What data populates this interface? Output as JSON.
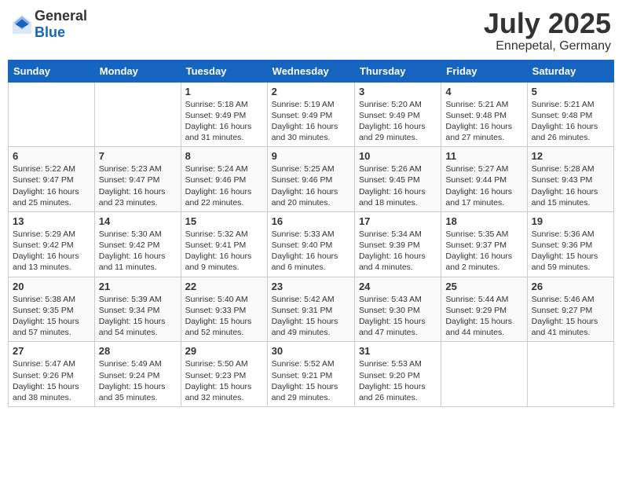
{
  "header": {
    "logo_general": "General",
    "logo_blue": "Blue",
    "month_year": "July 2025",
    "location": "Ennepetal, Germany"
  },
  "days_of_week": [
    "Sunday",
    "Monday",
    "Tuesday",
    "Wednesday",
    "Thursday",
    "Friday",
    "Saturday"
  ],
  "weeks": [
    [
      {
        "day": "",
        "data": ""
      },
      {
        "day": "",
        "data": ""
      },
      {
        "day": "1",
        "data": "Sunrise: 5:18 AM\nSunset: 9:49 PM\nDaylight: 16 hours and 31 minutes."
      },
      {
        "day": "2",
        "data": "Sunrise: 5:19 AM\nSunset: 9:49 PM\nDaylight: 16 hours and 30 minutes."
      },
      {
        "day": "3",
        "data": "Sunrise: 5:20 AM\nSunset: 9:49 PM\nDaylight: 16 hours and 29 minutes."
      },
      {
        "day": "4",
        "data": "Sunrise: 5:21 AM\nSunset: 9:48 PM\nDaylight: 16 hours and 27 minutes."
      },
      {
        "day": "5",
        "data": "Sunrise: 5:21 AM\nSunset: 9:48 PM\nDaylight: 16 hours and 26 minutes."
      }
    ],
    [
      {
        "day": "6",
        "data": "Sunrise: 5:22 AM\nSunset: 9:47 PM\nDaylight: 16 hours and 25 minutes."
      },
      {
        "day": "7",
        "data": "Sunrise: 5:23 AM\nSunset: 9:47 PM\nDaylight: 16 hours and 23 minutes."
      },
      {
        "day": "8",
        "data": "Sunrise: 5:24 AM\nSunset: 9:46 PM\nDaylight: 16 hours and 22 minutes."
      },
      {
        "day": "9",
        "data": "Sunrise: 5:25 AM\nSunset: 9:46 PM\nDaylight: 16 hours and 20 minutes."
      },
      {
        "day": "10",
        "data": "Sunrise: 5:26 AM\nSunset: 9:45 PM\nDaylight: 16 hours and 18 minutes."
      },
      {
        "day": "11",
        "data": "Sunrise: 5:27 AM\nSunset: 9:44 PM\nDaylight: 16 hours and 17 minutes."
      },
      {
        "day": "12",
        "data": "Sunrise: 5:28 AM\nSunset: 9:43 PM\nDaylight: 16 hours and 15 minutes."
      }
    ],
    [
      {
        "day": "13",
        "data": "Sunrise: 5:29 AM\nSunset: 9:42 PM\nDaylight: 16 hours and 13 minutes."
      },
      {
        "day": "14",
        "data": "Sunrise: 5:30 AM\nSunset: 9:42 PM\nDaylight: 16 hours and 11 minutes."
      },
      {
        "day": "15",
        "data": "Sunrise: 5:32 AM\nSunset: 9:41 PM\nDaylight: 16 hours and 9 minutes."
      },
      {
        "day": "16",
        "data": "Sunrise: 5:33 AM\nSunset: 9:40 PM\nDaylight: 16 hours and 6 minutes."
      },
      {
        "day": "17",
        "data": "Sunrise: 5:34 AM\nSunset: 9:39 PM\nDaylight: 16 hours and 4 minutes."
      },
      {
        "day": "18",
        "data": "Sunrise: 5:35 AM\nSunset: 9:37 PM\nDaylight: 16 hours and 2 minutes."
      },
      {
        "day": "19",
        "data": "Sunrise: 5:36 AM\nSunset: 9:36 PM\nDaylight: 15 hours and 59 minutes."
      }
    ],
    [
      {
        "day": "20",
        "data": "Sunrise: 5:38 AM\nSunset: 9:35 PM\nDaylight: 15 hours and 57 minutes."
      },
      {
        "day": "21",
        "data": "Sunrise: 5:39 AM\nSunset: 9:34 PM\nDaylight: 15 hours and 54 minutes."
      },
      {
        "day": "22",
        "data": "Sunrise: 5:40 AM\nSunset: 9:33 PM\nDaylight: 15 hours and 52 minutes."
      },
      {
        "day": "23",
        "data": "Sunrise: 5:42 AM\nSunset: 9:31 PM\nDaylight: 15 hours and 49 minutes."
      },
      {
        "day": "24",
        "data": "Sunrise: 5:43 AM\nSunset: 9:30 PM\nDaylight: 15 hours and 47 minutes."
      },
      {
        "day": "25",
        "data": "Sunrise: 5:44 AM\nSunset: 9:29 PM\nDaylight: 15 hours and 44 minutes."
      },
      {
        "day": "26",
        "data": "Sunrise: 5:46 AM\nSunset: 9:27 PM\nDaylight: 15 hours and 41 minutes."
      }
    ],
    [
      {
        "day": "27",
        "data": "Sunrise: 5:47 AM\nSunset: 9:26 PM\nDaylight: 15 hours and 38 minutes."
      },
      {
        "day": "28",
        "data": "Sunrise: 5:49 AM\nSunset: 9:24 PM\nDaylight: 15 hours and 35 minutes."
      },
      {
        "day": "29",
        "data": "Sunrise: 5:50 AM\nSunset: 9:23 PM\nDaylight: 15 hours and 32 minutes."
      },
      {
        "day": "30",
        "data": "Sunrise: 5:52 AM\nSunset: 9:21 PM\nDaylight: 15 hours and 29 minutes."
      },
      {
        "day": "31",
        "data": "Sunrise: 5:53 AM\nSunset: 9:20 PM\nDaylight: 15 hours and 26 minutes."
      },
      {
        "day": "",
        "data": ""
      },
      {
        "day": "",
        "data": ""
      }
    ]
  ]
}
